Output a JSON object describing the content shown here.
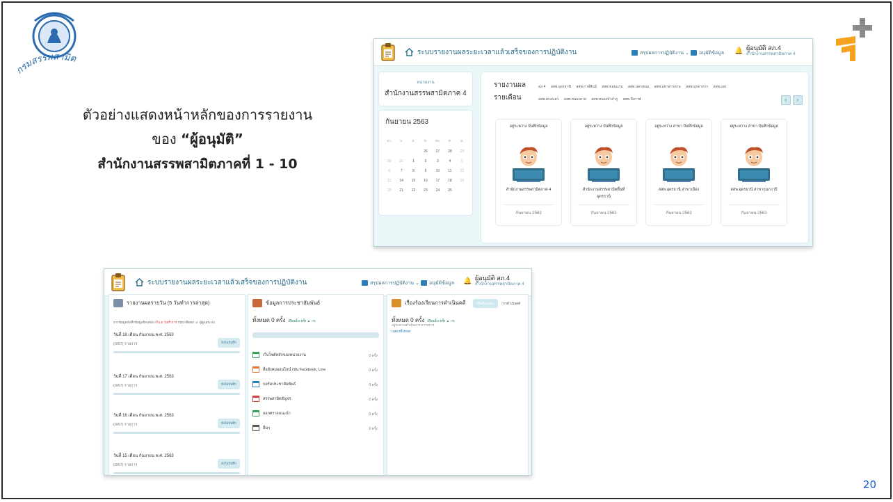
{
  "slide": {
    "seal_text": "กรมสรรพสามิต",
    "description": {
      "line1": "ตัวอย่างแสดงหน้าหลักของการรายงาน",
      "line2_prefix": "ของ ",
      "line2_bold": "“ผู้อนุมัติ”",
      "line3": "สำนักงานสรรพสามิตภาคที่ 1 - 10"
    },
    "page_number": "20"
  },
  "app": {
    "title": "ระบบรายงานผลระยะเวลาแล้วเสร็จของการปฏิบัติงาน",
    "menu_summary": "สรุปผลการปฏิบัติงาน",
    "menu_approve": "อนุมัติข้อมูล",
    "user_role": "ผู้อนุมัติ สภ.4",
    "user_unit": "สำนักงานสรรพสามิตภาค 4"
  },
  "screen1": {
    "unit_label": "หน่วยงาน",
    "unit_value": "สำนักงานสรรพสามิตภาค 4",
    "calendar": {
      "month": "กันยายน 2563",
      "headers": [
        "อา.",
        "จ.",
        "อ.",
        "พ.",
        "พฤ.",
        "ศ.",
        "ส."
      ],
      "rows": [
        [
          "",
          "",
          "",
          "",
          "26",
          "27",
          "28",
          "29"
        ],
        [
          "30",
          "31",
          "1",
          "2",
          "3",
          "4",
          "5"
        ],
        [
          "6",
          "7",
          "8",
          "9",
          "10",
          "11",
          "12"
        ],
        [
          "13",
          "14",
          "15",
          "16",
          "17",
          "18",
          "19"
        ],
        [
          "20",
          "21",
          "22",
          "23",
          "24",
          "25",
          ""
        ]
      ]
    },
    "report_heading_1": "รายงานผล",
    "report_heading_2": "รายเดือน",
    "chips_row1": [
      "สภ.4",
      "สสพ.อุดรธานี",
      "สสพ.กาฬสินธุ์",
      "สสพ.ขอนแก่น",
      "สสพ.นครพนม",
      "สสพ.มหาสารคาม",
      "สสพ.มุกดาหาร",
      "สสพ.เลย"
    ],
    "chips_row2": [
      "สสพ.สกลนคร",
      "สสพ.หนองคาย",
      "สสพ.หนองบัวลำภู",
      "สสพ.บึงกาฬ"
    ],
    "cards": [
      {
        "status": "อยู่ระหว่าง บันทึกข้อมูล",
        "name": "สำนักงานสรรพสามิตภาค 4",
        "date": "กันยายน 2563"
      },
      {
        "status": "อยู่ระหว่าง บันทึกข้อมูล",
        "name": "สำนักงานสรรพสามิตพื้นที่ อุดรธานี",
        "date": "กันยายน 2563"
      },
      {
        "status": "อยู่ระหว่าง สาขา บันทึกข้อมูล",
        "name": "สสพ.อุดรธานี สาขาเมือง",
        "date": "กันยายน 2563"
      },
      {
        "status": "อยู่ระหว่าง สาขา บันทึกข้อมูล",
        "name": "สสพ.อุดรธานี สาขากุมภวาปี",
        "date": "กันยายน 2563"
      }
    ]
  },
  "screen2": {
    "col1": {
      "heading": "รายงานผลรายวัน (5 วันทำการล่าสุด)",
      "notice_prefix": "จากข้อมูลบันทึกข้อมูลย้อนหลัง",
      "notice_red": "เกิน 5 วันทำการ",
      "notice_suffix": "กรุณาติดต่อ ☏ ผู้ดูแลระบบ",
      "days": [
        {
          "date": "วันที่ 18 เดือน กันยายน พ.ศ. 2563",
          "count": "(0/67) รายการ",
          "button": "ยังไม่บันทึก"
        },
        {
          "date": "วันที่ 17 เดือน กันยายน พ.ศ. 2563",
          "count": "(0/67) รายการ",
          "button": "ยังไม่บันทึก"
        },
        {
          "date": "วันที่ 16 เดือน กันยายน พ.ศ. 2563",
          "count": "(0/67) รายการ",
          "button": "ยังไม่บันทึก"
        },
        {
          "date": "วันที่ 15 เดือน กันยายน พ.ศ. 2563",
          "count": "(0/67) รายการ",
          "button": "ยังไม่บันทึก"
        }
      ]
    },
    "col2": {
      "heading": "ข้อมูลการประชาสัมพันธ์",
      "total": "ทั้งหมด 0 ครั้ง",
      "total_small": "เดือนนี้ 0 ครั้ง ▲ ~%",
      "items": [
        {
          "label": "เว็บไซต์หลักของหน่วยงาน",
          "count": "0 ครั้ง",
          "color": "#3aa35b"
        },
        {
          "label": "สื่อสังคมออนไลน์ เช่น Facebook, Line",
          "count": "0 ครั้ง",
          "color": "#e07b39"
        },
        {
          "label": "บอร์ดประชาสัมพันธ์",
          "count": "0 ครั้ง",
          "color": "#2c7fb8"
        },
        {
          "label": "สรรพสามิตสัญจร",
          "count": "0 ครั้ง",
          "color": "#d33d3d"
        },
        {
          "label": "ออกตรวจแนะนำ",
          "count": "0 ครั้ง",
          "color": "#3aa35b"
        },
        {
          "label": "อื่นๆ",
          "count": "0 ครั้ง",
          "color": "#555555"
        }
      ]
    },
    "col3": {
      "heading": "เรื่องร้องเรียนการดำเนินคดี",
      "tab_active": "เรื่องร้องเรียน",
      "tab_other": "การดำเนินคดี",
      "total": "ทั้งหมด 0 ครั้ง",
      "total_small": "เดือนนี้ 0 ครั้ง ▲ ~%",
      "sub": "อยู่ระหว่างดำเนินการ 0 รายการ",
      "show_all": "แสดงทั้งหมด"
    }
  }
}
